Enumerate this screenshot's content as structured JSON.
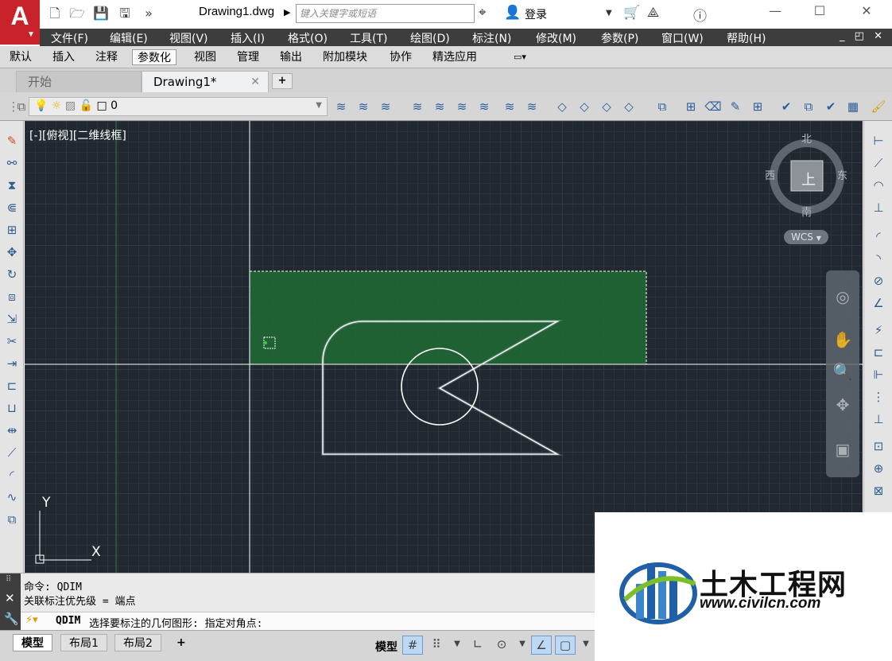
{
  "app": {
    "logo_letter": "A",
    "doc_title": "Drawing1.dwg",
    "search_placeholder": "键入关键字或短语",
    "login_label": "登录"
  },
  "menu": [
    "文件(F)",
    "编辑(E)",
    "视图(V)",
    "插入(I)",
    "格式(O)",
    "工具(T)",
    "绘图(D)",
    "标注(N)",
    "修改(M)",
    "参数(P)",
    "窗口(W)",
    "帮助(H)"
  ],
  "ribbon_tabs": [
    "默认",
    "插入",
    "注释",
    "参数化",
    "视图",
    "管理",
    "输出",
    "附加模块",
    "协作",
    "精选应用"
  ],
  "ribbon_active": "参数化",
  "file_tabs": {
    "start": "开始",
    "drawing": "Drawing1*",
    "add": "+"
  },
  "layer": {
    "name": "0"
  },
  "canvas": {
    "view_label": "[-][俯视][二维线框]",
    "compass": {
      "north": "北",
      "south": "南",
      "east": "东",
      "west": "西",
      "top_face": "上"
    },
    "wcs": "WCS",
    "ucs_x": "X",
    "ucs_y": "Y"
  },
  "command": {
    "line1": "命令: QDIM",
    "line2": "关联标注优先级 = 端点",
    "prompt_cmd": "QDIM",
    "prompt_text": "选择要标注的几何图形: 指定对角点:"
  },
  "status": {
    "tab_model": "模型",
    "tab_layout1": "布局1",
    "tab_layout2": "布局2",
    "add": "+",
    "model_label": "模型"
  },
  "watermark": {
    "name": "土木工程网",
    "url": "www.civilcn.com"
  },
  "colors": {
    "canvas_bg": "#212830",
    "selection_fill": "#1e6b34",
    "menu_bg": "#3d3d3d",
    "logo_red": "#c8232a",
    "crosshair": "#ffffff"
  }
}
